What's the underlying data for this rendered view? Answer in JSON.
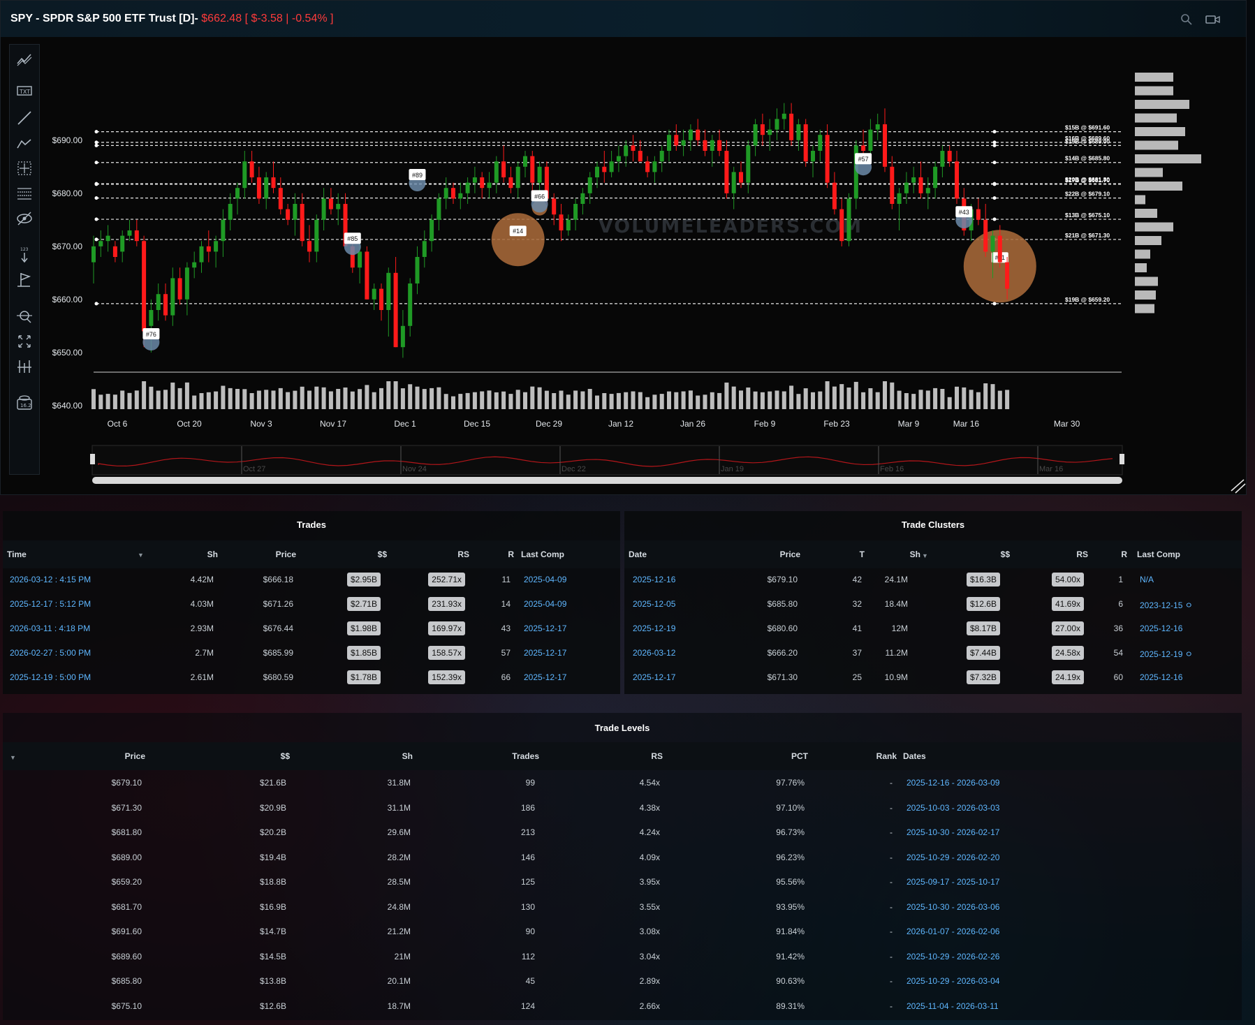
{
  "header": {
    "title": "SPY - SPDR S&P 500 ETF Trust [D]-",
    "price": "$662.48",
    "change": "[ $-3.58 | -0.54% ]"
  },
  "colors": {
    "up": "#1f9a25",
    "down": "#ff1a1a",
    "bubble": "#a86a3a",
    "link": "#5fb7ff",
    "background": "#070707"
  },
  "chart_data": {
    "type": "candlestick",
    "watermark": "VOLUMELEADERS.COM",
    "y_ticks": [
      "$690.00",
      "$680.00",
      "$670.00",
      "$660.00",
      "$650.00",
      "$640.00"
    ],
    "y_tick_values": [
      690,
      680,
      670,
      660,
      650,
      640
    ],
    "ylim": [
      636,
      698
    ],
    "x_ticks": [
      "Oct 6",
      "Oct 20",
      "Nov 3",
      "Nov 17",
      "Dec 1",
      "Dec 15",
      "Dec 29",
      "Jan 12",
      "Jan 26",
      "Feb 9",
      "Feb 23",
      "Mar 9",
      "Mar 16",
      "Mar 30"
    ],
    "x_tick_index": [
      0,
      10,
      20,
      30,
      40,
      50,
      60,
      70,
      80,
      90,
      100,
      110,
      118,
      132
    ],
    "candles": [
      [
        667,
        672,
        663,
        670
      ],
      [
        670,
        673,
        668,
        671
      ],
      [
        671,
        674,
        669,
        672
      ],
      [
        670,
        671,
        667,
        668
      ],
      [
        669,
        673,
        667,
        672
      ],
      [
        672,
        675,
        671,
        673
      ],
      [
        673,
        675,
        670,
        671
      ],
      [
        671,
        672,
        651,
        654
      ],
      [
        655,
        660,
        650,
        658
      ],
      [
        658,
        663,
        656,
        661
      ],
      [
        661,
        663,
        656,
        657
      ],
      [
        657,
        666,
        655,
        664
      ],
      [
        664,
        666,
        659,
        660
      ],
      [
        660,
        667,
        657,
        666
      ],
      [
        666,
        669,
        664,
        667
      ],
      [
        667,
        671,
        665,
        670
      ],
      [
        670,
        673,
        667,
        669
      ],
      [
        669,
        672,
        666,
        671
      ],
      [
        671,
        677,
        668,
        675
      ],
      [
        675,
        680,
        673,
        678
      ],
      [
        679,
        682,
        676,
        681
      ],
      [
        681,
        688,
        679,
        686
      ],
      [
        686,
        688,
        682,
        683
      ],
      [
        683,
        685,
        678,
        679
      ],
      [
        679,
        684,
        677,
        683
      ],
      [
        683,
        686,
        680,
        681
      ],
      [
        681,
        683,
        676,
        677
      ],
      [
        677,
        678,
        674,
        675
      ],
      [
        675,
        680,
        672,
        678
      ],
      [
        678,
        680,
        670,
        671
      ],
      [
        671,
        674,
        667,
        669
      ],
      [
        669,
        676,
        667,
        675
      ],
      [
        675,
        681,
        673,
        679
      ],
      [
        679,
        681,
        676,
        677
      ],
      [
        677,
        680,
        674,
        678
      ],
      [
        678,
        680,
        670,
        670
      ],
      [
        670,
        672,
        665,
        666
      ],
      [
        666,
        671,
        663,
        669
      ],
      [
        669,
        670,
        660,
        660
      ],
      [
        660,
        663,
        658,
        662
      ],
      [
        662,
        663,
        656,
        658
      ],
      [
        658,
        666,
        653,
        665
      ],
      [
        665,
        668,
        651,
        651
      ],
      [
        651,
        658,
        649,
        655
      ],
      [
        655,
        664,
        653,
        663
      ],
      [
        663,
        670,
        661,
        668
      ],
      [
        668,
        673,
        666,
        671
      ],
      [
        671,
        676,
        669,
        675
      ],
      [
        675,
        680,
        673,
        679
      ],
      [
        679,
        683,
        677,
        681
      ],
      [
        681,
        682,
        678,
        679
      ],
      [
        679,
        682,
        677,
        680
      ],
      [
        680,
        683,
        678,
        682
      ],
      [
        682,
        685,
        680,
        683
      ],
      [
        683,
        684,
        679,
        681
      ],
      [
        681,
        684,
        679,
        682
      ],
      [
        682,
        687,
        680,
        686
      ],
      [
        686,
        689,
        682,
        683
      ],
      [
        683,
        685,
        680,
        681
      ],
      [
        681,
        686,
        679,
        685
      ],
      [
        685,
        688,
        683,
        687
      ],
      [
        687,
        688,
        680,
        682
      ],
      [
        682,
        686,
        679,
        685
      ],
      [
        685,
        686,
        678,
        679
      ],
      [
        679,
        680,
        674,
        676
      ],
      [
        676,
        678,
        671,
        673
      ],
      [
        673,
        676,
        672,
        675
      ],
      [
        675,
        679,
        673,
        678
      ],
      [
        678,
        681,
        676,
        680
      ],
      [
        680,
        684,
        678,
        683
      ],
      [
        683,
        686,
        681,
        685
      ],
      [
        685,
        688,
        682,
        684
      ],
      [
        684,
        688,
        683,
        686
      ],
      [
        686,
        689,
        684,
        687
      ],
      [
        687,
        690,
        685,
        689
      ],
      [
        689,
        691,
        686,
        688
      ],
      [
        688,
        690,
        686,
        686
      ],
      [
        686,
        687,
        683,
        684
      ],
      [
        684,
        687,
        682,
        686
      ],
      [
        686,
        689,
        684,
        688
      ],
      [
        688,
        692,
        686,
        691
      ],
      [
        691,
        693,
        688,
        689
      ],
      [
        689,
        692,
        687,
        690
      ],
      [
        690,
        693,
        688,
        692
      ],
      [
        692,
        694,
        689,
        690
      ],
      [
        690,
        692,
        687,
        688
      ],
      [
        688,
        691,
        685,
        690
      ],
      [
        690,
        692,
        687,
        688
      ],
      [
        688,
        690,
        679,
        680
      ],
      [
        680,
        685,
        677,
        684
      ],
      [
        684,
        686,
        681,
        682
      ],
      [
        682,
        690,
        680,
        689
      ],
      [
        689,
        694,
        687,
        693
      ],
      [
        693,
        695,
        689,
        691
      ],
      [
        691,
        694,
        688,
        692
      ],
      [
        692,
        696,
        690,
        694
      ],
      [
        694,
        697,
        692,
        695
      ],
      [
        695,
        697,
        689,
        690
      ],
      [
        690,
        694,
        688,
        693
      ],
      [
        693,
        694,
        685,
        686
      ],
      [
        686,
        689,
        683,
        688
      ],
      [
        688,
        692,
        686,
        691
      ],
      [
        691,
        693,
        681,
        682
      ],
      [
        682,
        684,
        676,
        677
      ],
      [
        677,
        679,
        670,
        671
      ],
      [
        671,
        680,
        670,
        679
      ],
      [
        679,
        690,
        677,
        689
      ],
      [
        689,
        692,
        686,
        688
      ],
      [
        688,
        694,
        686,
        692
      ],
      [
        692,
        695,
        690,
        693
      ],
      [
        693,
        696,
        684,
        685
      ],
      [
        685,
        687,
        677,
        678
      ],
      [
        678,
        681,
        673,
        680
      ],
      [
        680,
        684,
        678,
        682
      ],
      [
        682,
        685,
        680,
        683
      ],
      [
        683,
        686,
        679,
        680
      ],
      [
        680,
        683,
        677,
        681
      ],
      [
        681,
        686,
        679,
        685
      ],
      [
        685,
        689,
        683,
        688
      ],
      [
        688,
        689,
        685,
        686
      ],
      [
        686,
        688,
        678,
        679
      ],
      [
        679,
        681,
        672,
        673
      ],
      [
        673,
        678,
        671,
        677
      ],
      [
        677,
        679,
        674,
        675
      ],
      [
        675,
        678,
        668,
        669
      ],
      [
        669,
        673,
        664,
        672
      ],
      [
        672,
        674,
        666,
        667
      ],
      [
        667,
        668,
        660,
        662
      ]
    ],
    "trade_markers": [
      {
        "label": "#76",
        "index": 8,
        "price": 653
      },
      {
        "label": "#85",
        "index": 36,
        "price": 671
      },
      {
        "label": "#89",
        "index": 45,
        "price": 683
      },
      {
        "label": "#66",
        "index": 62,
        "price": 679
      },
      {
        "label": "#57",
        "index": 107,
        "price": 686
      },
      {
        "label": "#43",
        "index": 121,
        "price": 676
      }
    ],
    "trade_bubbles": [
      {
        "label": "#14",
        "index": 59,
        "price": 671,
        "size": 38
      },
      {
        "label": "#11",
        "index": 126,
        "price": 666,
        "size": 52
      },
      {
        "label": "",
        "index": 62,
        "price": 677,
        "size": 11
      }
    ],
    "level_lines": [
      {
        "label": "$15B @ $691.60",
        "price": 691.6
      },
      {
        "label": "$16B @ $689.60",
        "price": 689.6
      },
      {
        "label": "$19B @ $689.00",
        "price": 689.0
      },
      {
        "label": "$14B @ $685.80",
        "price": 685.8
      },
      {
        "label": "$20B @ $681.80",
        "price": 681.8
      },
      {
        "label": "$17B @ $681.70",
        "price": 681.7
      },
      {
        "label": "$22B @ $679.10",
        "price": 679.1
      },
      {
        "label": "$13B @ $675.10",
        "price": 675.1
      },
      {
        "label": "$21B @ $671.30",
        "price": 671.3
      },
      {
        "label": "$19B @ $659.20",
        "price": 659.2
      }
    ],
    "volume_profile": [
      0.55,
      0.55,
      0.78,
      0.6,
      0.72,
      0.62,
      0.95,
      0.4,
      0.68,
      0.15,
      0.32,
      0.55,
      0.38,
      0.22,
      0.17,
      0.33,
      0.3,
      0.28
    ]
  },
  "navigator": {
    "labels": [
      "Oct 27",
      "Nov 24",
      "Dec 22",
      "Jan 19",
      "Feb 16",
      "Mar 16"
    ]
  },
  "trades": {
    "title": "Trades",
    "headers": [
      "Time",
      "Sh",
      "Price",
      "$$",
      "RS",
      "R",
      "Last Comp"
    ],
    "rows": [
      {
        "time": "2026-03-12 : 4:15 PM",
        "sh": "4.42M",
        "price": "$666.18",
        "dollars": "$2.95B",
        "rs": "252.71x",
        "r": "11",
        "last_comp": "2025-04-09"
      },
      {
        "time": "2025-12-17 : 5:12 PM",
        "sh": "4.03M",
        "price": "$671.26",
        "dollars": "$2.71B",
        "rs": "231.93x",
        "r": "14",
        "last_comp": "2025-04-09"
      },
      {
        "time": "2026-03-11 : 4:18 PM",
        "sh": "2.93M",
        "price": "$676.44",
        "dollars": "$1.98B",
        "rs": "169.97x",
        "r": "43",
        "last_comp": "2025-12-17"
      },
      {
        "time": "2026-02-27 : 5:00 PM",
        "sh": "2.7M",
        "price": "$685.99",
        "dollars": "$1.85B",
        "rs": "158.57x",
        "r": "57",
        "last_comp": "2025-12-17"
      },
      {
        "time": "2025-12-19 : 5:00 PM",
        "sh": "2.61M",
        "price": "$680.59",
        "dollars": "$1.78B",
        "rs": "152.39x",
        "r": "66",
        "last_comp": "2025-12-17"
      }
    ]
  },
  "clusters": {
    "title": "Trade Clusters",
    "headers": [
      "Date",
      "Price",
      "T",
      "Sh",
      "$$",
      "RS",
      "R",
      "Last Comp"
    ],
    "rows": [
      {
        "date": "2025-12-16",
        "price": "$679.10",
        "t": "42",
        "sh": "24.1M",
        "dollars": "$16.3B",
        "rs": "54.00x",
        "r": "1",
        "last_comp": "N/A"
      },
      {
        "date": "2025-12-05",
        "price": "$685.80",
        "t": "32",
        "sh": "18.4M",
        "dollars": "$12.6B",
        "rs": "41.69x",
        "r": "6",
        "last_comp": "2023-12-15 ㅇ"
      },
      {
        "date": "2025-12-19",
        "price": "$680.60",
        "t": "41",
        "sh": "12M",
        "dollars": "$8.17B",
        "rs": "27.00x",
        "r": "36",
        "last_comp": "2025-12-16"
      },
      {
        "date": "2026-03-12",
        "price": "$666.20",
        "t": "37",
        "sh": "11.2M",
        "dollars": "$7.44B",
        "rs": "24.58x",
        "r": "54",
        "last_comp": "2025-12-19 ㅇ"
      },
      {
        "date": "2025-12-17",
        "price": "$671.30",
        "t": "25",
        "sh": "10.9M",
        "dollars": "$7.32B",
        "rs": "24.19x",
        "r": "60",
        "last_comp": "2025-12-16"
      }
    ]
  },
  "levels": {
    "title": "Trade Levels",
    "headers": [
      "Price",
      "$$",
      "Sh",
      "Trades",
      "RS",
      "PCT",
      "Rank",
      "Dates"
    ],
    "rows": [
      {
        "price": "$679.10",
        "dollars": "$21.6B",
        "sh": "31.8M",
        "trades": "99",
        "rs": "4.54x",
        "pct": "97.76%",
        "rank": "-",
        "dates": "2025-12-16 - 2026-03-09"
      },
      {
        "price": "$671.30",
        "dollars": "$20.9B",
        "sh": "31.1M",
        "trades": "186",
        "rs": "4.38x",
        "pct": "97.10%",
        "rank": "-",
        "dates": "2025-10-03 - 2026-03-03"
      },
      {
        "price": "$681.80",
        "dollars": "$20.2B",
        "sh": "29.6M",
        "trades": "213",
        "rs": "4.24x",
        "pct": "96.73%",
        "rank": "-",
        "dates": "2025-10-30 - 2026-02-17"
      },
      {
        "price": "$689.00",
        "dollars": "$19.4B",
        "sh": "28.2M",
        "trades": "146",
        "rs": "4.09x",
        "pct": "96.23%",
        "rank": "-",
        "dates": "2025-10-29 - 2026-02-20"
      },
      {
        "price": "$659.20",
        "dollars": "$18.8B",
        "sh": "28.5M",
        "trades": "125",
        "rs": "3.95x",
        "pct": "95.56%",
        "rank": "-",
        "dates": "2025-09-17 - 2025-10-17"
      },
      {
        "price": "$681.70",
        "dollars": "$16.9B",
        "sh": "24.8M",
        "trades": "130",
        "rs": "3.55x",
        "pct": "93.95%",
        "rank": "-",
        "dates": "2025-10-30 - 2026-03-06"
      },
      {
        "price": "$691.60",
        "dollars": "$14.7B",
        "sh": "21.2M",
        "trades": "90",
        "rs": "3.08x",
        "pct": "91.84%",
        "rank": "-",
        "dates": "2026-01-07 - 2026-02-06"
      },
      {
        "price": "$689.60",
        "dollars": "$14.5B",
        "sh": "21M",
        "trades": "112",
        "rs": "3.04x",
        "pct": "91.42%",
        "rank": "-",
        "dates": "2025-10-29 - 2026-02-26"
      },
      {
        "price": "$685.80",
        "dollars": "$13.8B",
        "sh": "20.1M",
        "trades": "45",
        "rs": "2.89x",
        "pct": "90.63%",
        "rank": "-",
        "dates": "2025-10-29 - 2026-03-04"
      },
      {
        "price": "$675.10",
        "dollars": "$12.6B",
        "sh": "18.7M",
        "trades": "124",
        "rs": "2.66x",
        "pct": "89.31%",
        "rank": "-",
        "dates": "2025-11-04 - 2026-03-11"
      }
    ]
  },
  "toolbar_icons": [
    "trend-icon",
    "text-icon",
    "line-icon",
    "pattern-icon",
    "crosshair-icon",
    "fib-icon",
    "hide-icon",
    "measure-icon",
    "flag-icon",
    "zoom-icon",
    "fullscreen-icon",
    "indicator-icon",
    "save-icon"
  ]
}
